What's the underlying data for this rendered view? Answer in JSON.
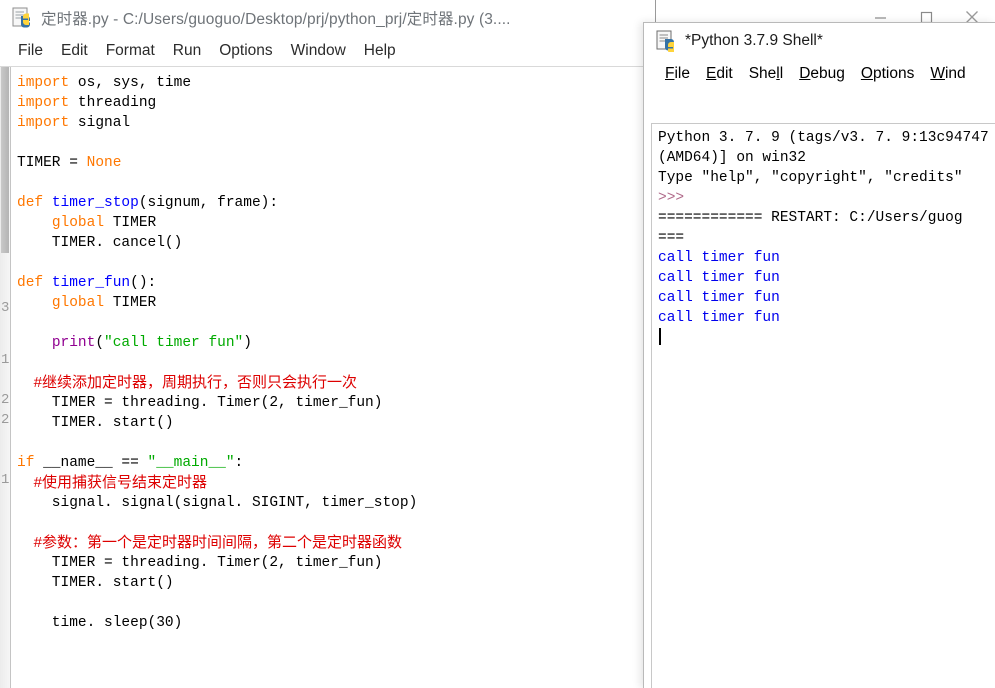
{
  "editor": {
    "icon": "python-file-icon",
    "title": "定时器.py - C:/Users/guoguo/Desktop/prj/python_prj/定时器.py (3....",
    "window_buttons": {
      "minimize": "—",
      "maximize": "▢",
      "close": "✕"
    },
    "menu": [
      "File",
      "Edit",
      "Format",
      "Run",
      "Options",
      "Window",
      "Help"
    ],
    "gutter_digits": [
      "3",
      "1",
      "2",
      "2",
      "1"
    ],
    "code_lines": [
      [
        {
          "t": "import",
          "c": "kw"
        },
        {
          "t": " os, sys, time",
          "c": ""
        }
      ],
      [
        {
          "t": "import",
          "c": "kw"
        },
        {
          "t": " threading",
          "c": ""
        }
      ],
      [
        {
          "t": "import",
          "c": "kw"
        },
        {
          "t": " signal",
          "c": ""
        }
      ],
      [],
      [
        {
          "t": "TIMER = ",
          "c": ""
        },
        {
          "t": "None",
          "c": "kw"
        }
      ],
      [],
      [
        {
          "t": "def ",
          "c": "kw"
        },
        {
          "t": "timer_stop",
          "c": "fn"
        },
        {
          "t": "(signum, frame):",
          "c": ""
        }
      ],
      [
        {
          "t": "    ",
          "c": ""
        },
        {
          "t": "global",
          "c": "kw"
        },
        {
          "t": " TIMER",
          "c": ""
        }
      ],
      [
        {
          "t": "    TIMER. cancel()",
          "c": ""
        }
      ],
      [],
      [
        {
          "t": "def ",
          "c": "kw"
        },
        {
          "t": "timer_fun",
          "c": "fn"
        },
        {
          "t": "():",
          "c": ""
        }
      ],
      [
        {
          "t": "    ",
          "c": ""
        },
        {
          "t": "global",
          "c": "kw"
        },
        {
          "t": " TIMER",
          "c": ""
        }
      ],
      [],
      [
        {
          "t": "    ",
          "c": ""
        },
        {
          "t": "print",
          "c": "bi"
        },
        {
          "t": "(",
          "c": ""
        },
        {
          "t": "\"call timer fun\"",
          "c": "str"
        },
        {
          "t": ")",
          "c": ""
        }
      ],
      [],
      [
        {
          "t": "    #继续添加定时器，周期执行，否则只会执行一次",
          "c": "cm"
        }
      ],
      [
        {
          "t": "    TIMER = threading. Timer(2, timer_fun)",
          "c": ""
        }
      ],
      [
        {
          "t": "    TIMER. start()",
          "c": ""
        }
      ],
      [],
      [
        {
          "t": "if ",
          "c": "kw"
        },
        {
          "t": "__name__ == ",
          "c": ""
        },
        {
          "t": "\"__main__\"",
          "c": "str"
        },
        {
          "t": ":",
          "c": ""
        }
      ],
      [
        {
          "t": "    #使用捕获信号结束定时器",
          "c": "cm"
        }
      ],
      [
        {
          "t": "    signal. signal(signal. SIGINT, timer_stop)",
          "c": ""
        }
      ],
      [],
      [
        {
          "t": "    #参数：第一个是定时器时间间隔，第二个是定时器函数",
          "c": "cm"
        }
      ],
      [
        {
          "t": "    TIMER = threading. Timer(2, timer_fun)",
          "c": ""
        }
      ],
      [
        {
          "t": "    TIMER. start()",
          "c": ""
        }
      ],
      [],
      [
        {
          "t": "    time. sleep(30)",
          "c": ""
        }
      ]
    ]
  },
  "shell": {
    "icon": "python-shell-icon",
    "title": "*Python 3.7.9 Shell*",
    "menu": [
      {
        "label": "File",
        "mnemonic": "F"
      },
      {
        "label": "Edit",
        "mnemonic": "E"
      },
      {
        "label": "Shell",
        "mnemonic": "l"
      },
      {
        "label": "Debug",
        "mnemonic": "D"
      },
      {
        "label": "Options",
        "mnemonic": "O"
      },
      {
        "label": "Wind",
        "mnemonic": "W"
      }
    ],
    "output_lines": [
      [
        {
          "t": "Python 3. 7. 9 (tags/v3. 7. 9:13c94747",
          "c": ""
        }
      ],
      [
        {
          "t": "(AMD64)] on win32",
          "c": ""
        }
      ],
      [
        {
          "t": "Type \"help\", \"copyright\", \"credits\"",
          "c": ""
        }
      ],
      [
        {
          "t": ">>>",
          "c": "prompt"
        }
      ],
      [
        {
          "t": "============ RESTART: C:/Users/guog",
          "c": ""
        }
      ],
      [
        {
          "t": "===",
          "c": ""
        }
      ],
      [
        {
          "t": "call timer fun",
          "c": "stdout"
        }
      ],
      [
        {
          "t": "call timer fun",
          "c": "stdout"
        }
      ],
      [
        {
          "t": "call timer fun",
          "c": "stdout"
        }
      ],
      [
        {
          "t": "call timer fun",
          "c": "stdout"
        }
      ],
      [
        {
          "t": "",
          "c": "caret"
        }
      ]
    ]
  },
  "colors": {
    "keyword": "#ff7700",
    "builtin": "#900090",
    "function_def": "#0000ff",
    "string": "#00aa00",
    "comment": "#dd0000",
    "prompt": "#b06a8a",
    "stdout": "#0000ee"
  }
}
